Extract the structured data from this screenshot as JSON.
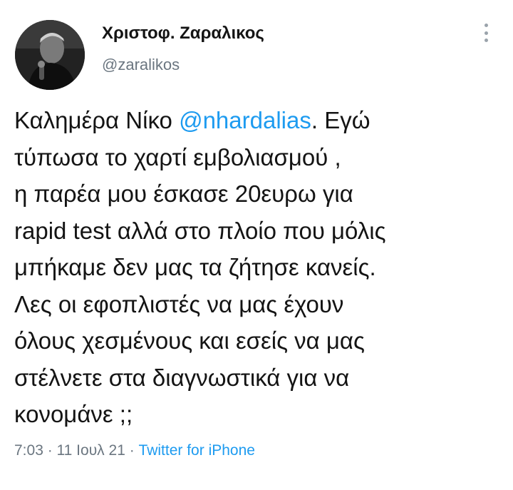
{
  "author": {
    "display_name": "Χριστοφ. Ζαραλικος",
    "handle": "@zaralikos"
  },
  "tweet": {
    "line1_before": "Καλημέρα Νίκο ",
    "line1_mention": "@nhardalias",
    "line1_after": ". Εγώ",
    "line2": "τύπωσα το χαρτί εμβολιασμού ,",
    "line3": "η παρέα μου έσκασε 20ευρω για",
    "line4": "rapid test αλλά στο πλοίο που μόλις",
    "line5": "μπήκαμε δεν μας τα ζήτησε κανείς.",
    "line6": "Λες οι εφοπλιστές να μας έχουν",
    "line7": "όλους χεσμένους και εσείς να μας",
    "line8": "στέλνετε στα διαγνωστικά για να",
    "line9": "κονομάνε ;;"
  },
  "meta": {
    "time": "7:03",
    "sep1": " · ",
    "date": "11 Ιουλ 21",
    "sep2": " · ",
    "source": "Twitter for iPhone"
  },
  "colors": {
    "link": "#1d9bf0",
    "secondary_text": "#6b7680",
    "primary_text": "#141414"
  },
  "icons": {
    "more": "vertical-ellipsis-icon"
  }
}
